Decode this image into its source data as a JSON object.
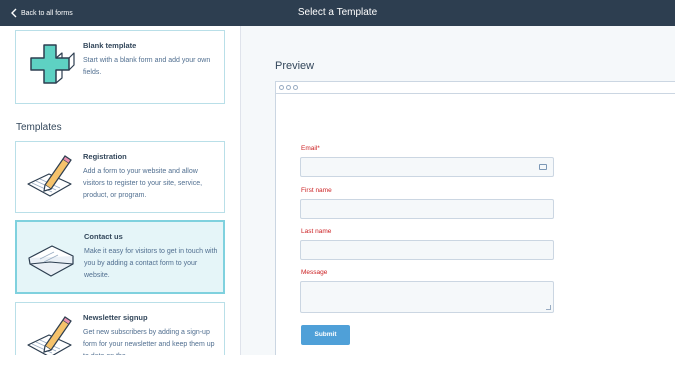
{
  "topbar": {
    "back_label": "Back to all forms",
    "title": "Select a Template"
  },
  "left": {
    "blank": {
      "title": "Blank template",
      "description": "Start with a blank form and add your own fields.",
      "icon": "medical-cross-icon"
    },
    "section_title": "Templates",
    "templates": [
      {
        "title": "Registration",
        "description": "Add a form to your website and allow visitors to register to your site, service, product, or program.",
        "icon": "pencil-paper-icon",
        "selected": false
      },
      {
        "title": "Contact us",
        "description": "Make it easy for visitors to get in touch with you by adding a contact form to your website.",
        "icon": "envelope-icon",
        "selected": true
      },
      {
        "title": "Newsletter signup",
        "description": "Get new subscribers by adding a sign-up form for your newsletter and keep them up to date on the",
        "icon": "pencil-paper-icon",
        "selected": false
      }
    ]
  },
  "preview": {
    "label": "Preview",
    "fields": [
      {
        "label": "Email*",
        "type": "email"
      },
      {
        "label": "First name",
        "type": "text"
      },
      {
        "label": "Last name",
        "type": "text"
      },
      {
        "label": "Message",
        "type": "textarea"
      }
    ],
    "submit_label": "Submit"
  },
  "colors": {
    "topbar": "#2d3e50",
    "selected_card_bg": "#e5f5f8",
    "card_border": "#7fd1de",
    "required_label": "#cc2224",
    "submit_button": "#4fa0d8",
    "icon_teal": "#5ed1c3"
  }
}
